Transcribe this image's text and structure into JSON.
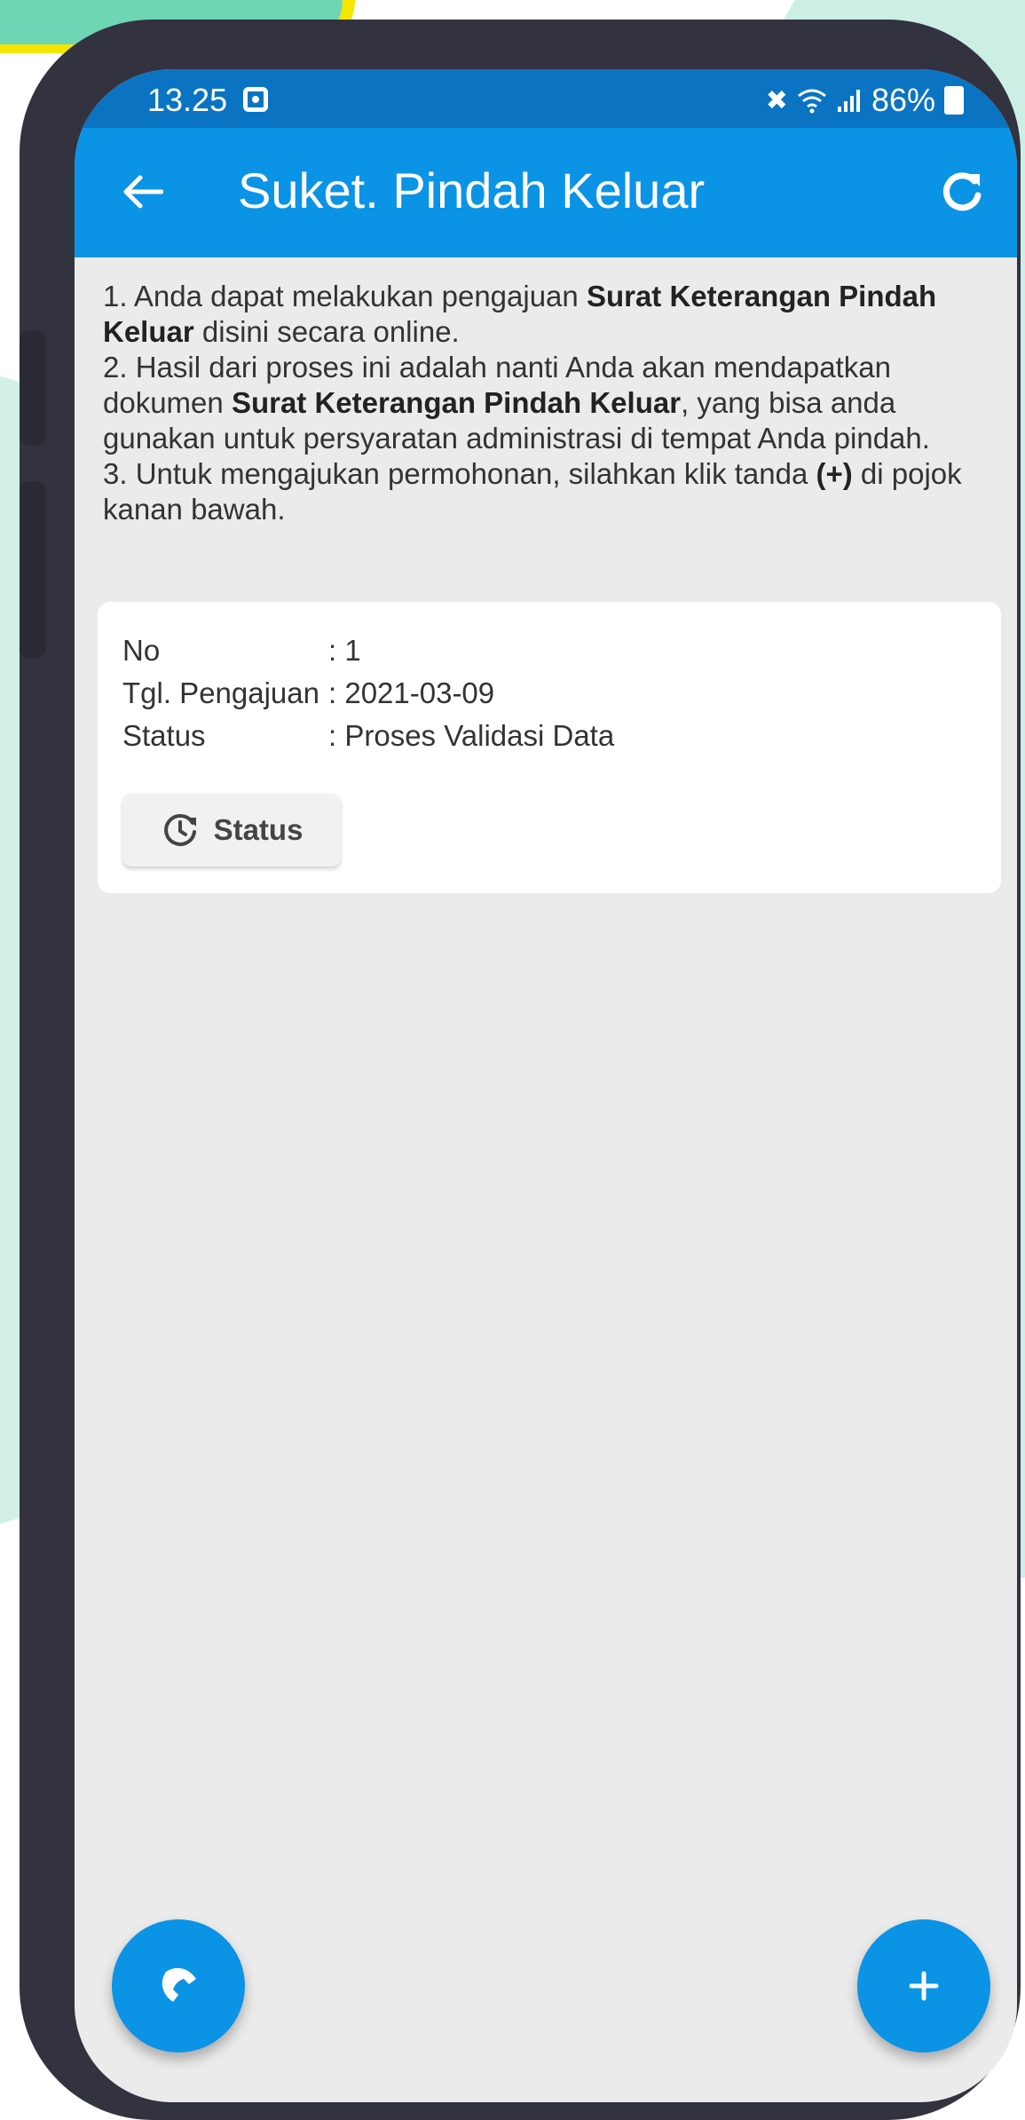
{
  "status_bar": {
    "time": "13.25",
    "battery": "86%",
    "icons": [
      "notification-icon",
      "mute-icon",
      "wifi-icon",
      "signal-icon",
      "battery-icon"
    ]
  },
  "app_bar": {
    "title": "Suket. Pindah Keluar",
    "back_icon": "arrow-left-icon",
    "refresh_icon": "refresh-icon"
  },
  "instructions": {
    "line1_a": "1. Anda dapat melakukan pengajuan ",
    "line1_b": "Surat Keterangan Pindah Keluar",
    "line1_c": " disini secara online.",
    "line2_a": "2. Hasil dari proses ini adalah nanti Anda akan mendapatkan dokumen ",
    "line2_b": "Surat Keterangan Pindah Keluar",
    "line2_c": ", yang bisa anda gunakan untuk persyaratan administrasi di tempat Anda pindah.",
    "line3_a": "3. Untuk mengajukan permohonan, silahkan klik tanda ",
    "line3_b": "(+)",
    "line3_c": " di pojok kanan bawah."
  },
  "submission": {
    "no_label": "No",
    "no_value": ": 1",
    "date_label": "Tgl. Pengajuan",
    "date_value": ": 2021-03-09",
    "status_label": "Status",
    "status_value": ": Proses Validasi Data",
    "status_button": "Status"
  },
  "fab": {
    "call_icon": "phone-icon",
    "add_icon": "plus-icon"
  },
  "colors": {
    "app_bar": "#0b93e6",
    "status_bar": "#0a74c2",
    "screen_bg": "#ebebeb",
    "phone_frame": "#33323f",
    "background_accent": "#cdeee4"
  }
}
